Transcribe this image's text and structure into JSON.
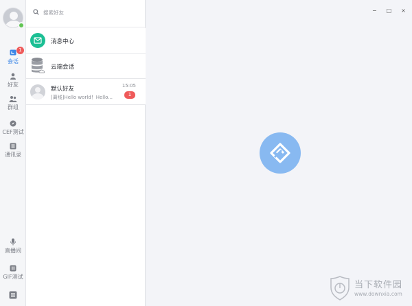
{
  "nav": {
    "items": [
      {
        "label": "会话",
        "icon": "chat-icon",
        "badge": "1",
        "active": true
      },
      {
        "label": "好友",
        "icon": "person-icon"
      },
      {
        "label": "群组",
        "icon": "group-icon"
      },
      {
        "label": "CEF测试",
        "icon": "compass-icon"
      },
      {
        "label": "通讯录",
        "icon": "contacts-icon"
      }
    ],
    "bottom_items": [
      {
        "label": "直播间",
        "icon": "microphone-icon"
      },
      {
        "label": "GIF测试",
        "icon": "pause-icon"
      }
    ],
    "menu_icon": "menu-icon"
  },
  "search": {
    "placeholder": "搜索好友"
  },
  "list": {
    "message_center": {
      "title": "消息中心"
    },
    "cloud_chat": {
      "title": "云端会话"
    },
    "friend": {
      "name": "默认好友",
      "preview": "[离线]Hello world！Hello...",
      "time": "15:05",
      "unread": "1"
    }
  },
  "window": {
    "minimize": "−",
    "maximize": "□",
    "close": "×"
  },
  "watermark": {
    "title": "当下软件园",
    "url": "www.downxia.com"
  },
  "colors": {
    "accent": "#3b86e6",
    "badge": "#ef5a5a",
    "message_center": "#1cbf94",
    "logo": "#88b9f1",
    "online": "#62c554"
  }
}
